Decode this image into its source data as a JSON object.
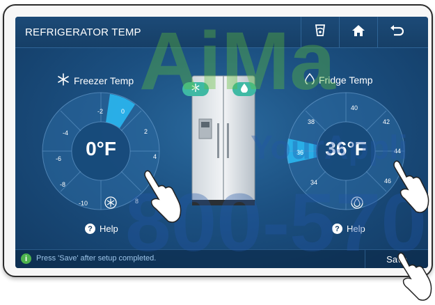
{
  "header": {
    "title": "REFRIGERATOR TEMP",
    "buttons": [
      {
        "name": "filter-icon"
      },
      {
        "name": "home-icon"
      },
      {
        "name": "back-icon"
      }
    ]
  },
  "freezer": {
    "label": "Freezer Temp",
    "value": "0°F",
    "selected": "0",
    "ticks": [
      "-2",
      "0",
      "2",
      "4",
      "6",
      "8",
      "",
      "-10",
      "-8",
      "-6",
      "-4"
    ],
    "help": "Help"
  },
  "fridge": {
    "label": "Fridge Temp",
    "value": "36°F",
    "selected": "36",
    "ticks": [
      "40",
      "42",
      "44",
      "46",
      "",
      "34",
      "36",
      "38"
    ],
    "help": "Help"
  },
  "footer": {
    "message": "Press  'Save'  after setup completed.",
    "save": "Save"
  },
  "watermark": {
    "line1": "AiMa",
    "line2": "YourAppli",
    "line3": "800-570"
  },
  "colors": {
    "selected_segment": "#2ab7f0",
    "dial": "#2b6aa0",
    "freezer_badge": "#3fb9a4",
    "fridge_badge": "#3fb9a4",
    "watermark_green": "#5fbf3a",
    "watermark_blue": "#2257a8"
  }
}
